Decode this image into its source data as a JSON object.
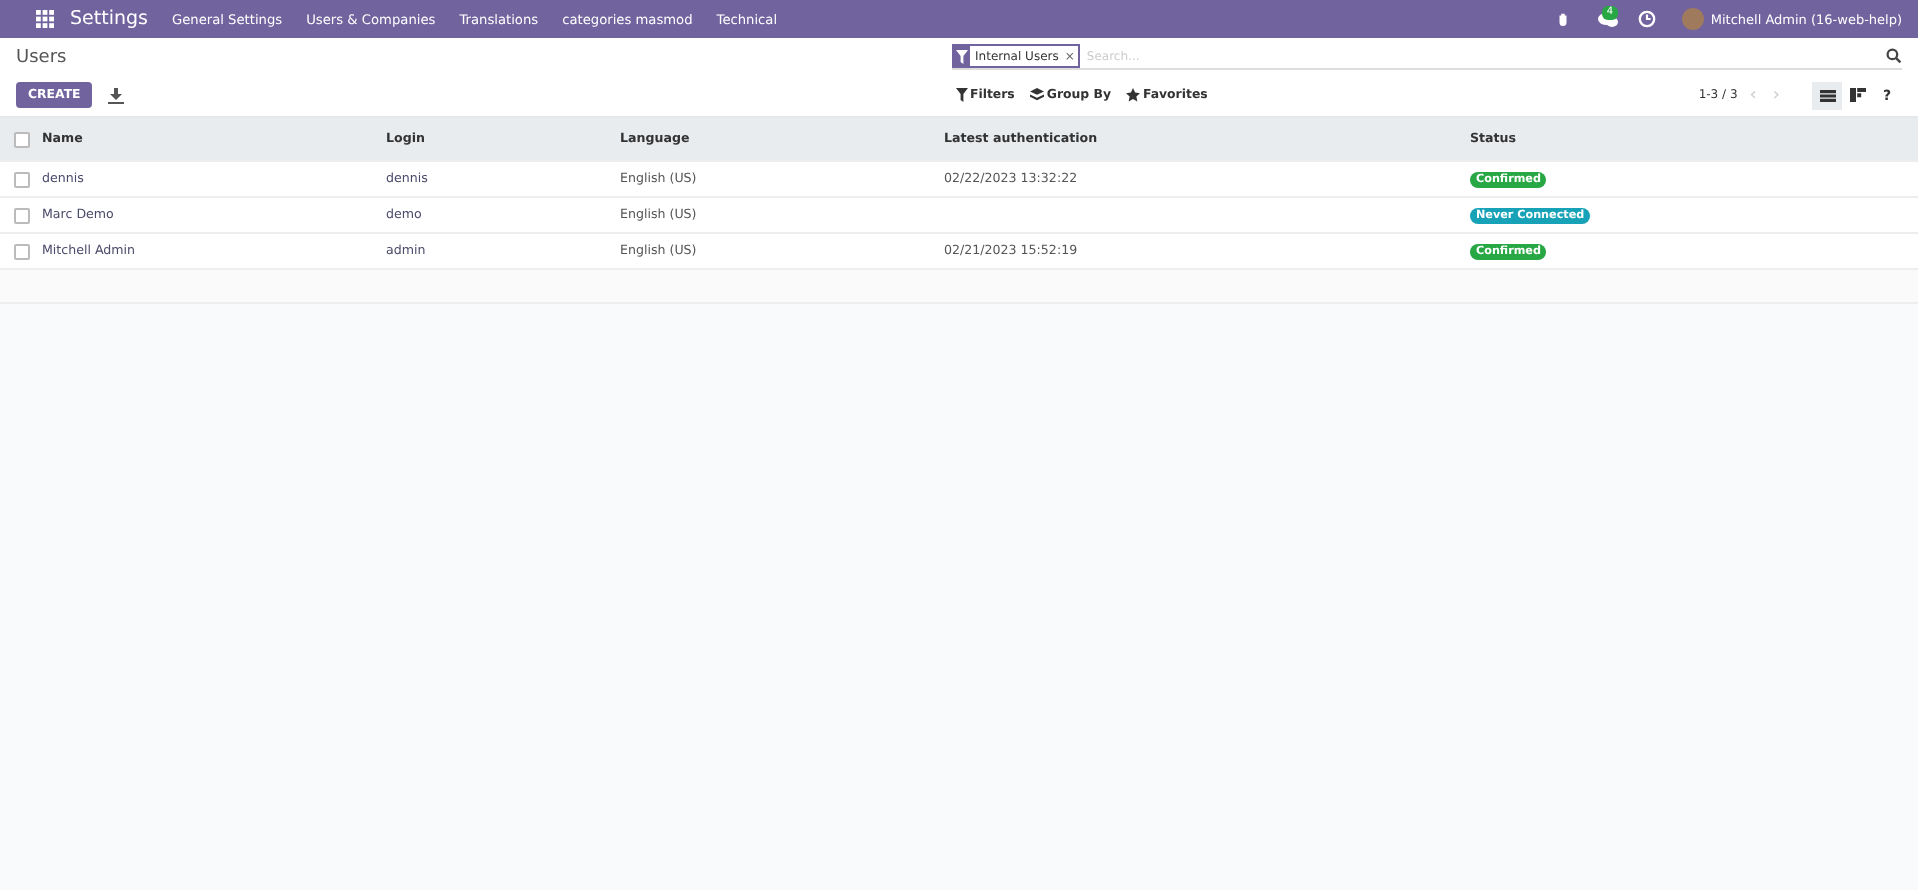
{
  "navbar": {
    "app": "Settings",
    "menu": [
      "General Settings",
      "Users & Companies",
      "Translations",
      "categories masmod",
      "Technical"
    ],
    "chat_count": "4",
    "user": "Mitchell Admin (16-web-help)"
  },
  "page": {
    "title": "Users",
    "create": "CREATE"
  },
  "search": {
    "facet": "Internal Users",
    "facet_remove": "×",
    "placeholder": "Search..."
  },
  "filters": [
    "Filters",
    "Group By",
    "Favorites"
  ],
  "pager": {
    "range": "1-3 / 3",
    "prev": "‹",
    "next": "›"
  },
  "views": [
    {
      "kind": "list",
      "selected": true
    },
    {
      "kind": "kanban",
      "selected": false
    }
  ],
  "help": "?",
  "table": {
    "select_all": false,
    "columns": [
      "Name",
      "Login",
      "Language",
      "Latest authentication",
      "Status"
    ],
    "rows": [
      {
        "checked": false,
        "cells": [
          "dennis",
          "dennis",
          "English (US)",
          "02/22/2023 13:32:22"
        ],
        "status": {
          "label": "Confirmed",
          "color": "#28a745"
        }
      },
      {
        "checked": false,
        "cells": [
          "Marc Demo",
          "demo",
          "English (US)",
          ""
        ],
        "status": {
          "label": "Never Connected",
          "color": "#17a2b8"
        }
      },
      {
        "checked": false,
        "cells": [
          "Mitchell Admin",
          "admin",
          "English (US)",
          "02/21/2023 15:52:19"
        ],
        "status": {
          "label": "Confirmed",
          "color": "#28a745"
        }
      }
    ]
  }
}
